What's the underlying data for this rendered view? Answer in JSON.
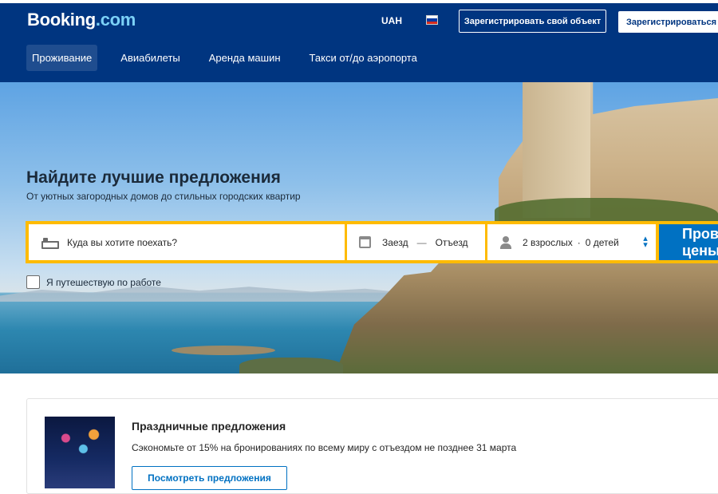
{
  "header": {
    "logo_main": "Booking",
    "logo_suffix": ".com",
    "currency": "UAH",
    "flag_colors": [
      "#ffffff",
      "#0039a6",
      "#d52b1e"
    ],
    "list_property_label": "Зарегистрировать свой объект",
    "register_label": "Зарегистрироваться",
    "nav": [
      {
        "label": "Проживание",
        "active": true
      },
      {
        "label": "Авиабилеты"
      },
      {
        "label": "Аренда машин"
      },
      {
        "label": "Такси от/до аэропорта"
      }
    ]
  },
  "hero": {
    "title": "Найдите лучшие предложения",
    "subtitle": "От уютных загородных домов до стильных городских квартир"
  },
  "search": {
    "destination_placeholder": "Куда вы хотите поехать?",
    "checkin_label": "Заезд",
    "dash": "—",
    "checkout_label": "Отъезд",
    "adults": "2 взрослых",
    "separator": "·",
    "children": "0 детей",
    "button_label": "Проверить цены",
    "work_travel_label": "Я путешествую по работе",
    "work_travel_checked": false
  },
  "promo": {
    "title": "Праздничные предложения",
    "text": "Сэкономьте от 15% на бронированиях по всему миру с отъездом не позднее 31 марта",
    "button_label": "Посмотреть предложения"
  },
  "colors": {
    "brand_dark": "#003580",
    "brand_blue": "#0071c2",
    "search_border": "#febb02"
  }
}
